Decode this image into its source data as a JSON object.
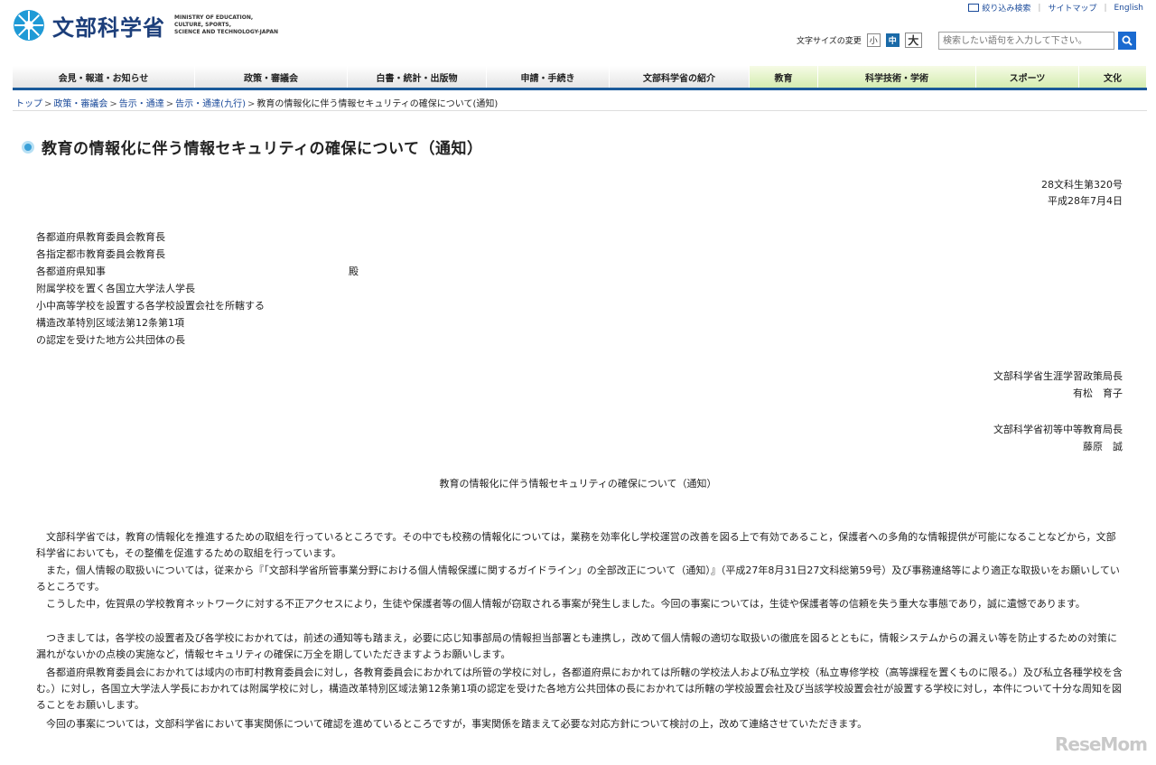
{
  "header": {
    "logo_jp": "文部科学省",
    "logo_en": "MINISTRY OF EDUCATION,\nCULTURE, SPORTS,\nSCIENCE AND TECHNOLOGY-JAPAN",
    "util_links": [
      "絞り込み検索",
      "サイトマップ",
      "English"
    ],
    "fontsize_label": "文字サイズの変更",
    "fontsize_buttons": [
      "小",
      "中",
      "大"
    ],
    "search_placeholder": "検索したい語句を入力して下さい。"
  },
  "nav": {
    "items": [
      "会見・報道・お知らせ",
      "政策・審議会",
      "白書・統計・出版物",
      "申請・手続き",
      "文部科学省の紹介",
      "教育",
      "科学技術・学術",
      "スポーツ",
      "文化"
    ]
  },
  "breadcrumb": {
    "items": [
      "トップ",
      "政策・審議会",
      "告示・通達",
      "告示・通達(九行)"
    ],
    "current": "教育の情報化に伴う情報セキュリティの確保について(通知)"
  },
  "page_title": "教育の情報化に伴う情報セキュリティの確保について（通知）",
  "document": {
    "number": "28文科生第320号",
    "date": "平成28年7月4日",
    "recipients": [
      "各都道府県教育委員会教育長",
      "各指定都市教育委員会教育長",
      "各都道府県知事",
      "附属学校を置く各国立大学法人学長",
      "小中高等学校を設置する各学校設置会社を所轄する",
      "構造改革特別区域法第12条第1項",
      "の認定を受けた地方公共団体の長"
    ],
    "honorific": "殿",
    "sender1_title": "文部科学省生涯学習政策局長",
    "sender1_name": "有松　育子",
    "sender2_title": "文部科学省初等中等教育局長",
    "sender2_name": "藤原　誠",
    "subject": "教育の情報化に伴う情報セキュリティの確保について（通知）",
    "paragraphs": [
      "文部科学省では，教育の情報化を推進するための取組を行っているところです。その中でも校務の情報化については，業務を効率化し学校運営の改善を図る上で有効であること，保護者への多角的な情報提供が可能になることなどから，文部科学省においても，その整備を促進するための取組を行っています。",
      "また，個人情報の取扱いについては，従来から『「文部科学省所管事業分野における個人情報保護に関するガイドライン」の全部改正について（通知）』（平成27年8月31日27文科総第59号）及び事務連絡等により適正な取扱いをお願いしているところです。",
      "こうした中，佐賀県の学校教育ネットワークに対する不正アクセスにより，生徒や保護者等の個人情報が窃取される事案が発生しました。今回の事案については，生徒や保護者等の信頼を失う重大な事態であり，誠に遺憾であります。",
      "つきましては，各学校の設置者及び各学校におかれては，前述の通知等も踏まえ，必要に応じ知事部局の情報担当部署とも連携し，改めて個人情報の適切な取扱いの徹底を図るとともに，情報システムからの漏えい等を防止するための対策に漏れがないかの点検の実施など，情報セキュリティの確保に万全を期していただきますようお願いします。",
      "各都道府県教育委員会におかれては域内の市町村教育委員会に対し，各教育委員会におかれては所管の学校に対し，各都道府県におかれては所轄の学校法人および私立学校（私立専修学校（高等課程を置くものに限る。）及び私立各種学校を含む。）に対し，各国立大学法人学長におかれては附属学校に対し，構造改革特別区域法第12条第1項の認定を受けた各地方公共団体の長におかれては所轄の学校設置会社及び当該学校設置会社が設置する学校に対し，本件について十分な周知を図ることをお願いします。",
      "今回の事案については，文部科学省において事実関係について確認を進めているところですが，事実関係を踏まえて必要な対応方針について検討の上，改めて連絡させていただきます。"
    ]
  },
  "watermark": "ReseMom"
}
